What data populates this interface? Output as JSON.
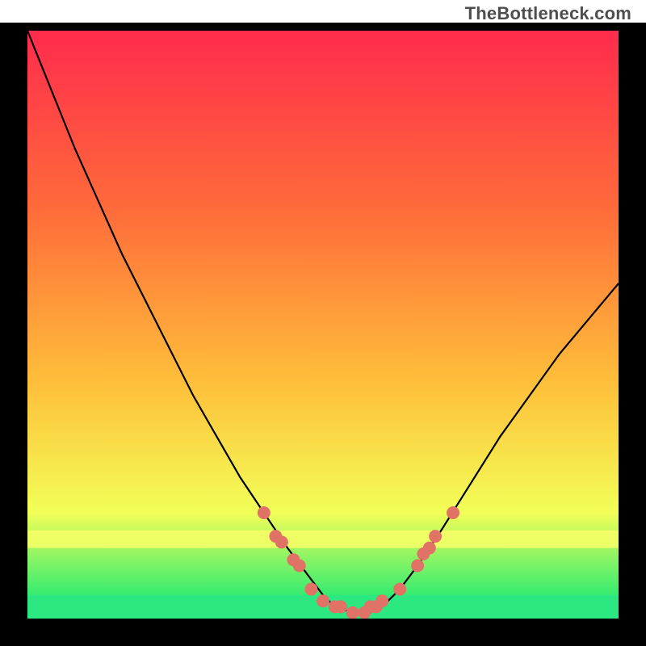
{
  "watermark": "TheBottleneck.com",
  "colors": {
    "frame": "#000000",
    "curve": "#000000",
    "marker": "#e17366",
    "band_green": "#2ce881",
    "band_yellow": "#f8ff66",
    "grad_top": "#ff2b4d",
    "grad_mid": "#ffbf3a",
    "grad_bottom": "#00e676"
  },
  "chart_data": {
    "type": "line",
    "title": "",
    "xlabel": "",
    "ylabel": "",
    "xlim": [
      0,
      100
    ],
    "ylim": [
      0,
      100
    ],
    "grid": false,
    "legend": false,
    "series": [
      {
        "name": "bottleneck-curve",
        "x": [
          0,
          4,
          8,
          12,
          16,
          20,
          24,
          28,
          32,
          36,
          40,
          44,
          47,
          50,
          52,
          55,
          58,
          60,
          63,
          66,
          70,
          75,
          80,
          85,
          90,
          95,
          100
        ],
        "y": [
          100,
          90,
          80,
          71,
          62,
          54,
          46,
          38,
          31,
          24,
          18,
          12,
          8,
          4,
          2,
          1,
          1,
          2,
          5,
          9,
          15,
          23,
          31,
          38,
          45,
          51,
          57
        ]
      }
    ],
    "markers": [
      {
        "x": 40,
        "y": 18
      },
      {
        "x": 42,
        "y": 14
      },
      {
        "x": 43,
        "y": 13
      },
      {
        "x": 45,
        "y": 10
      },
      {
        "x": 46,
        "y": 9
      },
      {
        "x": 48,
        "y": 5
      },
      {
        "x": 50,
        "y": 3
      },
      {
        "x": 52,
        "y": 2
      },
      {
        "x": 53,
        "y": 2
      },
      {
        "x": 55,
        "y": 1
      },
      {
        "x": 57,
        "y": 1
      },
      {
        "x": 58,
        "y": 2
      },
      {
        "x": 59,
        "y": 2
      },
      {
        "x": 60,
        "y": 3
      },
      {
        "x": 63,
        "y": 5
      },
      {
        "x": 66,
        "y": 9
      },
      {
        "x": 67,
        "y": 11
      },
      {
        "x": 68,
        "y": 12
      },
      {
        "x": 69,
        "y": 14
      },
      {
        "x": 72,
        "y": 18
      }
    ],
    "bands": [
      {
        "name": "yellow-band",
        "y0": 12,
        "y1": 15,
        "color_key": "band_yellow"
      },
      {
        "name": "green-band",
        "y0": 0,
        "y1": 4,
        "color_key": "band_green"
      }
    ]
  }
}
